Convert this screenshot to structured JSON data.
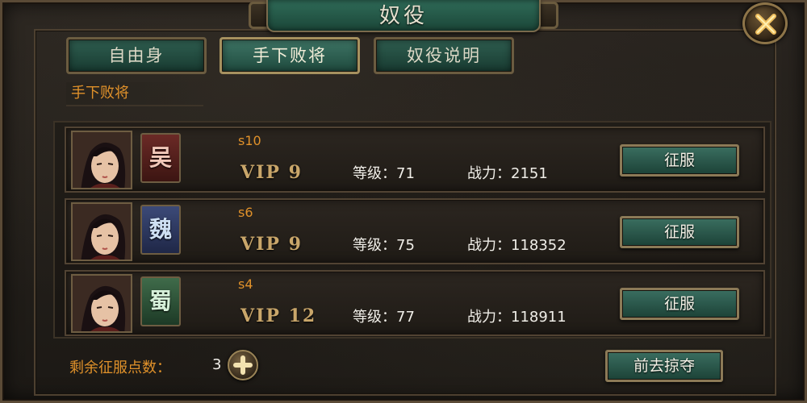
{
  "window": {
    "title": "奴役"
  },
  "tabs": [
    {
      "label": "自由身",
      "active": false
    },
    {
      "label": "手下败将",
      "active": true
    },
    {
      "label": "奴役说明",
      "active": false
    }
  ],
  "section": {
    "label": "手下败将"
  },
  "rows": [
    {
      "server": "s10",
      "vip": "VIP 9",
      "faction": "吴",
      "level_text": "等级：71",
      "power_text": "战力：2151",
      "action": "征服"
    },
    {
      "server": "s6",
      "vip": "VIP 9",
      "faction": "魏",
      "level_text": "等级：75",
      "power_text": "战力：118352",
      "action": "征服"
    },
    {
      "server": "s4",
      "vip": "VIP 12",
      "faction": "蜀",
      "level_text": "等级：77",
      "power_text": "战力：118911",
      "action": "征服"
    }
  ],
  "footer": {
    "remaining_label": "剩余征服点数：",
    "remaining_count": "3",
    "plunder_button": "前去掠夺"
  },
  "colors": {
    "accent_orange": "#e0912a",
    "button_green": "#2f6b58",
    "frame_gold": "#8c7a57",
    "faction_wu": "#6b2a26",
    "faction_wei": "#3c4a78",
    "faction_shu": "#3f6b4a"
  },
  "icons": {
    "close": "close-x-icon",
    "add": "plus-icon",
    "portrait": "character-portrait"
  }
}
